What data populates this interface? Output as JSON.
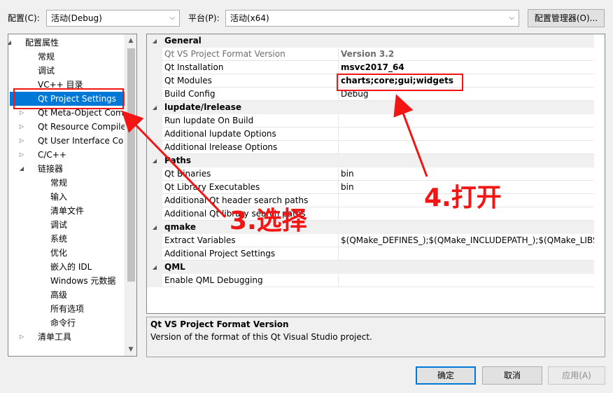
{
  "toolbar": {
    "config_label": "配置(C):",
    "config_value": "活动(Debug)",
    "platform_label": "平台(P):",
    "platform_value": "活动(x64)",
    "config_manager_button": "配置管理器(O)..."
  },
  "tree": {
    "items": [
      {
        "label": "配置属性",
        "expander": "expanded",
        "level": 0
      },
      {
        "label": "常规",
        "level": 1
      },
      {
        "label": "调试",
        "level": 1
      },
      {
        "label": "VC++ 目录",
        "level": 1
      },
      {
        "label": "Qt Project Settings",
        "level": 1,
        "selected": true
      },
      {
        "label": "Qt Meta-Object Com",
        "expander": "collapsed",
        "level": 1
      },
      {
        "label": "Qt Resource Compile",
        "expander": "collapsed",
        "level": 1
      },
      {
        "label": "Qt User Interface Co",
        "expander": "collapsed",
        "level": 1
      },
      {
        "label": "C/C++",
        "expander": "collapsed",
        "level": 1
      },
      {
        "label": "链接器",
        "expander": "expanded",
        "level": 1
      },
      {
        "label": "常规",
        "level": 2
      },
      {
        "label": "输入",
        "level": 2
      },
      {
        "label": "清单文件",
        "level": 2
      },
      {
        "label": "调试",
        "level": 2
      },
      {
        "label": "系统",
        "level": 2
      },
      {
        "label": "优化",
        "level": 2
      },
      {
        "label": "嵌入的 IDL",
        "level": 2
      },
      {
        "label": "Windows 元数据",
        "level": 2
      },
      {
        "label": "高级",
        "level": 2
      },
      {
        "label": "所有选项",
        "level": 2
      },
      {
        "label": "命令行",
        "level": 2
      },
      {
        "label": "清单工具",
        "expander": "collapsed",
        "level": 1
      }
    ],
    "scroll_up": "▲",
    "scroll_down": "▼"
  },
  "grid": {
    "rows": [
      {
        "type": "category",
        "name": "General"
      },
      {
        "type": "property",
        "name": "Qt VS Project Format Version",
        "value": "Version 3.2",
        "readonly": true,
        "bold": true
      },
      {
        "type": "property",
        "name": "Qt Installation",
        "value": "msvc2017_64",
        "bold": true
      },
      {
        "type": "property",
        "name": "Qt Modules",
        "value": "charts;core;gui;widgets",
        "bold": true
      },
      {
        "type": "property",
        "name": "Build Config",
        "value": "Debug"
      },
      {
        "type": "category",
        "name": "lupdate/lrelease"
      },
      {
        "type": "property",
        "name": "Run lupdate On Build",
        "value": ""
      },
      {
        "type": "property",
        "name": "Additional lupdate Options",
        "value": ""
      },
      {
        "type": "property",
        "name": "Additional lrelease Options",
        "value": ""
      },
      {
        "type": "category",
        "name": "Paths"
      },
      {
        "type": "property",
        "name": "Qt Binaries",
        "value": "bin"
      },
      {
        "type": "property",
        "name": "Qt Library Executables",
        "value": "bin"
      },
      {
        "type": "property",
        "name": "Additional Qt header search paths",
        "value": ""
      },
      {
        "type": "property",
        "name": "Additional Qt library search paths",
        "value": ""
      },
      {
        "type": "category",
        "name": "qmake"
      },
      {
        "type": "property",
        "name": "Extract Variables",
        "value": "$(QMake_DEFINES_);$(QMake_INCLUDEPATH_);$(QMake_LIBS_);$"
      },
      {
        "type": "property",
        "name": "Additional Project Settings",
        "value": ""
      },
      {
        "type": "category",
        "name": "QML"
      },
      {
        "type": "property",
        "name": "Enable QML Debugging",
        "value": ""
      }
    ]
  },
  "description": {
    "title": "Qt VS Project Format Version",
    "text": "Version of the format of this Qt Visual Studio project."
  },
  "buttons": {
    "ok": "确定",
    "cancel": "取消",
    "apply": "应用(A)"
  },
  "annotations": {
    "step3": "3.选择",
    "step4": "4.打开"
  },
  "colors": {
    "selection": "#0078d7",
    "annotation_red": "#f31414"
  }
}
